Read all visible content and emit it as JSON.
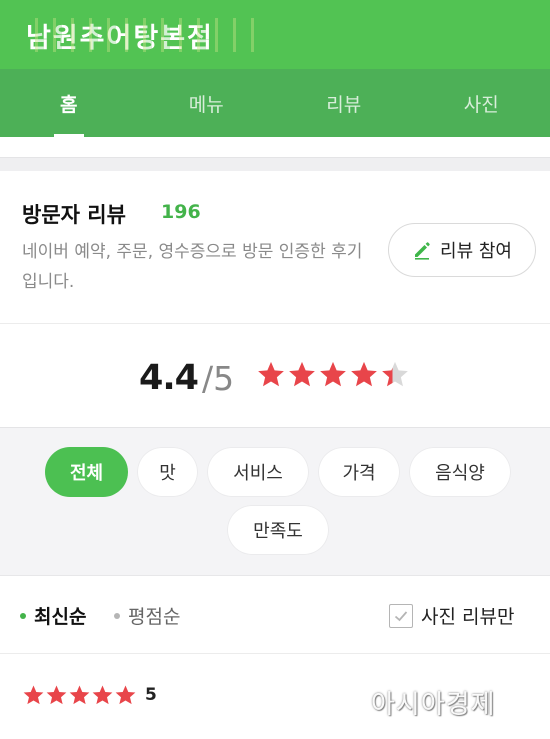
{
  "header": {
    "title": "남원추어탕본점"
  },
  "tabs": [
    {
      "label": "홈",
      "active": true
    },
    {
      "label": "메뉴",
      "active": false
    },
    {
      "label": "리뷰",
      "active": false
    },
    {
      "label": "사진",
      "active": false
    }
  ],
  "review_section": {
    "title": "방문자 리뷰",
    "count": "196",
    "description": "네이버 예약, 주문, 영수증으로 방문 인증한 후기입니다.",
    "write_button": "리뷰 참여"
  },
  "rating": {
    "score": "4.4",
    "max": "/5",
    "value": 4.4,
    "stars_total": 5
  },
  "filter_chips": [
    {
      "label": "전체",
      "active": true
    },
    {
      "label": "맛",
      "active": false
    },
    {
      "label": "서비스",
      "active": false
    },
    {
      "label": "가격",
      "active": false
    },
    {
      "label": "음식양",
      "active": false
    },
    {
      "label": "만족도",
      "active": false
    }
  ],
  "sort": {
    "options": [
      {
        "label": "최신순",
        "active": true
      },
      {
        "label": "평점순",
        "active": false
      }
    ],
    "photo_only_label": "사진 리뷰만",
    "photo_only_checked": false
  },
  "first_review": {
    "stars": 5,
    "score": "5"
  },
  "watermark": "아시아경제",
  "colors": {
    "brand_green": "#52c353",
    "tab_green": "#4db057",
    "count_green": "#43b34a",
    "star_red": "#e8454a",
    "star_empty": "#d9d9d9"
  }
}
